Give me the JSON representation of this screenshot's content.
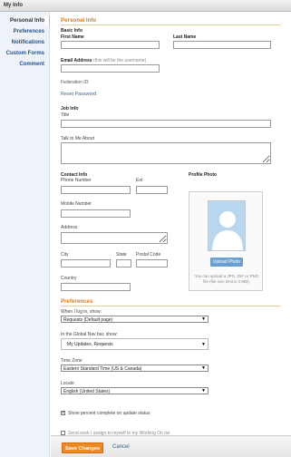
{
  "window": {
    "title": "My Info"
  },
  "sidebar": {
    "items": [
      {
        "label": "Personal Info",
        "active": true
      },
      {
        "label": "Preferences",
        "active": false
      },
      {
        "label": "Notifications",
        "active": false
      },
      {
        "label": "Custom Forms",
        "active": false
      },
      {
        "label": "Comment",
        "active": false
      }
    ]
  },
  "personal_info": {
    "section_title": "Personal Info",
    "basic_info": {
      "heading": "Basic Info",
      "first_name_label": "First Name",
      "first_name_value": "",
      "last_name_label": "Last Name",
      "last_name_value": "",
      "email_label": "Email Address",
      "email_note": "(this will be the username)",
      "email_value": "",
      "federation_label": "Federation ID:",
      "reset_password": "Reset Password"
    },
    "job_info": {
      "heading": "Job Info",
      "title_label": "Title",
      "title_value": "",
      "about_label": "Talk to Me About"
    },
    "contact_info": {
      "heading": "Contact Info",
      "phone_label": "Phone Number",
      "ext_label": "Ext",
      "mobile_label": "Mobile Number",
      "address_label": "Address",
      "city_label": "City",
      "state_label": "State",
      "postal_label": "Postal Code",
      "country_label": "Country"
    },
    "profile_photo": {
      "heading": "Profile Photo",
      "upload_button": "Upload Photo",
      "help_text": "You can upload a JPG, GIF or PNG file (file size limit is 4 MB)."
    }
  },
  "preferences": {
    "section_title": "Preferences",
    "login_label": "When I log in, show:",
    "login_value": "Requests (Default page)",
    "global_nav_label": "In the Global Nav bar, show:",
    "global_nav_value": "My Updates, Requests",
    "timezone_label": "Time Zone",
    "timezone_value": "Eastern Standard Time (US & Canada)",
    "locale_label": "Locale",
    "locale_value": "English (United States)",
    "show_percent_label": "Show percent complete on update status",
    "show_percent_checked": true,
    "partial_label": "Send work I assign to myself to my Working On list"
  },
  "footer": {
    "save_label": "Save Changes",
    "cancel_label": "Cancel"
  },
  "colors": {
    "accent_orange": "#e07a0f",
    "sidebar_bg": "#eef3fa",
    "link_blue": "#23538c",
    "save_button": "#ed8a26",
    "upload_button": "#6c9fd1"
  }
}
